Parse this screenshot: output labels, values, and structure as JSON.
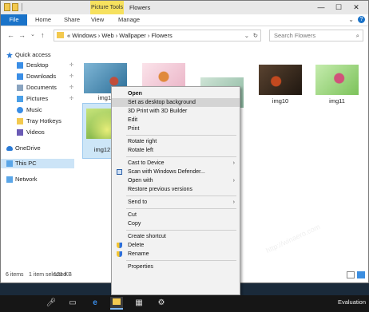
{
  "window": {
    "title": "Flowers",
    "contextual_tab": "Picture Tools",
    "controls": [
      "—",
      "☐",
      "✕"
    ]
  },
  "ribbon": {
    "tabs": [
      "File",
      "Home",
      "Share",
      "View",
      "Manage"
    ],
    "expand_glyph": "⌄",
    "help_glyph": "?"
  },
  "nav": {
    "back": "←",
    "forward": "→",
    "dropdown": "⌄",
    "up": "↑"
  },
  "address": {
    "prefix": "«",
    "crumbs": "Windows › Web › Wallpaper › Flowers",
    "dropdown": "⌄",
    "refresh": "↻"
  },
  "search": {
    "placeholder": "Search Flowers",
    "icon": "search-icon"
  },
  "sidebar": {
    "items": [
      {
        "label": "Quick access",
        "icon": "star-icon"
      },
      {
        "label": "Desktop",
        "icon": "desktop-icon",
        "pinned": true
      },
      {
        "label": "Downloads",
        "icon": "downloads-icon",
        "pinned": true
      },
      {
        "label": "Documents",
        "icon": "documents-icon",
        "pinned": true
      },
      {
        "label": "Pictures",
        "icon": "pictures-icon",
        "pinned": true
      },
      {
        "label": "Music",
        "icon": "music-icon"
      },
      {
        "label": "Tray Hotkeys",
        "icon": "folder-icon"
      },
      {
        "label": "Videos",
        "icon": "videos-icon"
      },
      {
        "label": "OneDrive",
        "icon": "cloud-icon"
      },
      {
        "label": "This PC",
        "icon": "computer-icon"
      },
      {
        "label": "Network",
        "icon": "network-icon"
      }
    ],
    "pin_glyph": "✢"
  },
  "files": [
    {
      "label": "img1",
      "colors": [
        "#4b8fb4",
        "#c24d3a"
      ]
    },
    {
      "label": "",
      "colors": [
        "#f5d6e0",
        "#e08a3c"
      ]
    },
    {
      "label": "",
      "colors": [
        "#a8c9b8",
        "#d94b8b"
      ]
    },
    {
      "label": "img10",
      "colors": [
        "#3a2c20",
        "#c2491f"
      ]
    },
    {
      "label": "img11",
      "colors": [
        "#a8d98a",
        "#d0527a"
      ]
    },
    {
      "label": "img12",
      "colors": [
        "#9ac94b",
        "#e3e86b"
      ]
    }
  ],
  "status": {
    "item_count": "6 items",
    "selected": "1 item selected",
    "size": "121 KB"
  },
  "context_menu": {
    "items": [
      {
        "label": "Open",
        "bold": true
      },
      {
        "label": "Set as desktop background",
        "highlight": true
      },
      {
        "label": "3D Print with 3D Builder"
      },
      {
        "label": "Edit"
      },
      {
        "label": "Print"
      },
      {
        "sep": true
      },
      {
        "label": "Rotate right"
      },
      {
        "label": "Rotate left"
      },
      {
        "sep": true
      },
      {
        "label": "Cast to Device",
        "submenu": true
      },
      {
        "label": "Scan with Windows Defender...",
        "icon": "defender-icon"
      },
      {
        "label": "Open with",
        "submenu": true
      },
      {
        "label": "Restore previous versions"
      },
      {
        "sep": true
      },
      {
        "label": "Send to",
        "submenu": true
      },
      {
        "sep": true
      },
      {
        "label": "Cut"
      },
      {
        "label": "Copy"
      },
      {
        "sep": true
      },
      {
        "label": "Create shortcut"
      },
      {
        "label": "Delete",
        "icon": "shield-icon"
      },
      {
        "label": "Rename",
        "icon": "shield-icon"
      },
      {
        "sep": true
      },
      {
        "label": "Properties"
      }
    ],
    "submenu_arrow": "›"
  },
  "watermark": "http://winaero.com",
  "taskbar": {
    "items": [
      "microphone-icon",
      "task-view-icon",
      "edge-icon",
      "file-explorer-icon",
      "store-icon",
      "settings-icon"
    ],
    "right_text": "Evaluation"
  },
  "colors": {
    "accent": "#1a73c9",
    "contextual_tab": "#f6e15f",
    "selection": "#cce4f7"
  }
}
